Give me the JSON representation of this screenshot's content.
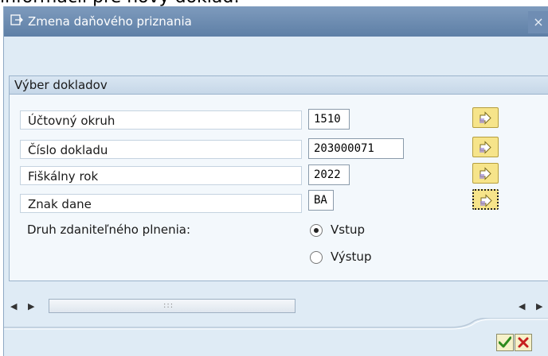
{
  "top_cut_text": "informácií pre nový doklad:",
  "window": {
    "title": "Zmena daňového priznania",
    "close_label": "×"
  },
  "group": {
    "title": "Výber dokladov"
  },
  "fields": [
    {
      "label": "Účtovný okruh",
      "value": "1510"
    },
    {
      "label": "Číslo dokladu",
      "value": "203000071"
    },
    {
      "label": "Fiškálny rok",
      "value": "2022"
    },
    {
      "label": "Znak dane",
      "value": "BA"
    }
  ],
  "supply_type": {
    "label": "Druh zdaniteľného plnenia:",
    "options": [
      {
        "label": "Vstup",
        "selected": true
      },
      {
        "label": "Výstup",
        "selected": false
      }
    ]
  },
  "scrollbar": {
    "grip": ":::"
  },
  "buttons": {
    "ok_icon": "checkmark-icon",
    "cancel_icon": "cross-icon"
  },
  "colors": {
    "titlebar": "#6c8bb3",
    "arrow_button": "#f6e48a",
    "ok_check": "#2e8b1e",
    "cancel_x": "#c62020"
  }
}
